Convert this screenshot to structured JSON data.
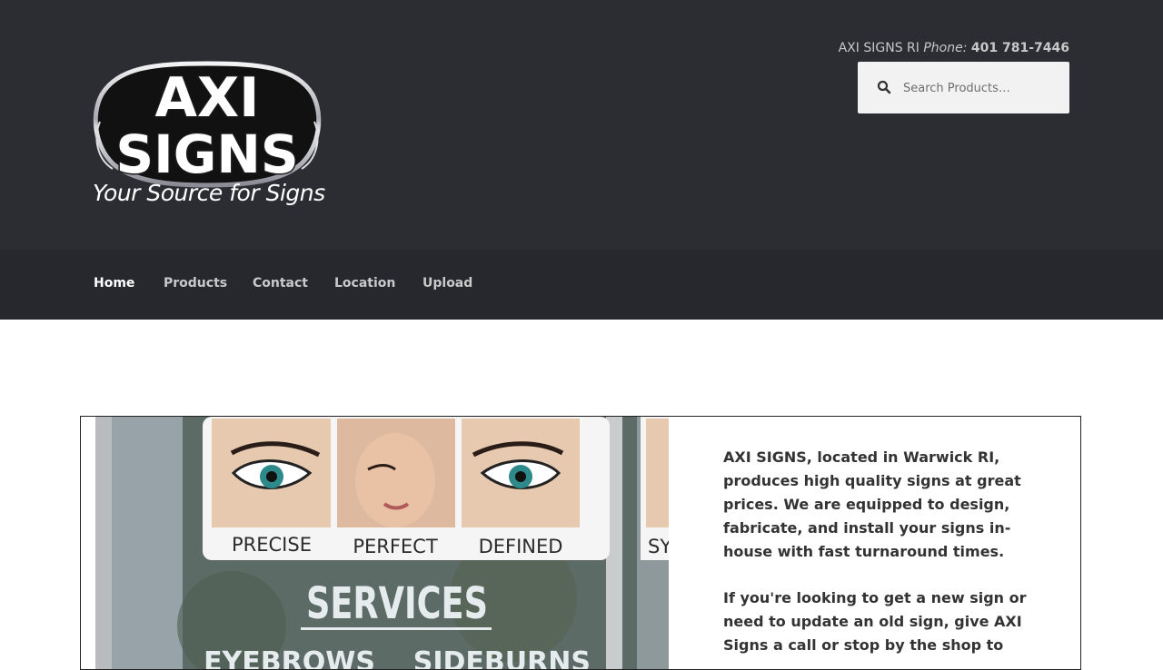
{
  "header": {
    "logo": {
      "top_text": "AXI",
      "bottom_text": "SIGNS",
      "tagline": "Your Source for Signs"
    },
    "contact": {
      "company": "AXI SIGNS RI",
      "phone_label": "Phone:",
      "phone_number": "401 781-7446"
    },
    "search": {
      "placeholder": "Search Products…",
      "icon": "search-icon"
    }
  },
  "nav": {
    "items": [
      {
        "label": "Home",
        "active": true
      },
      {
        "label": "Products",
        "active": false
      },
      {
        "label": "Contact",
        "active": false
      },
      {
        "label": "Location",
        "active": false
      },
      {
        "label": "Upload",
        "active": false
      }
    ]
  },
  "main": {
    "photo": {
      "captions": [
        "PRECISE",
        "PERFECT",
        "DEFINED",
        "SY"
      ],
      "sign_title": "SERVICES",
      "sign_line": "EYEBROWS    SIDEBURNS"
    },
    "paragraphs": [
      "AXI SIGNS, located in Warwick RI, produces high quality signs at great prices. We are equipped to design, fabricate, and install your signs in-house with fast turnaround times.",
      "If you're looking to get a new sign or need to update an old sign, give AXI Signs a call or stop by the shop to"
    ]
  },
  "colors": {
    "header_bg": "#2c2d33",
    "nav_bg": "#27282d",
    "nav_active": "#ffffff",
    "nav_text": "#c9c9c9",
    "body_text": "#333333"
  }
}
